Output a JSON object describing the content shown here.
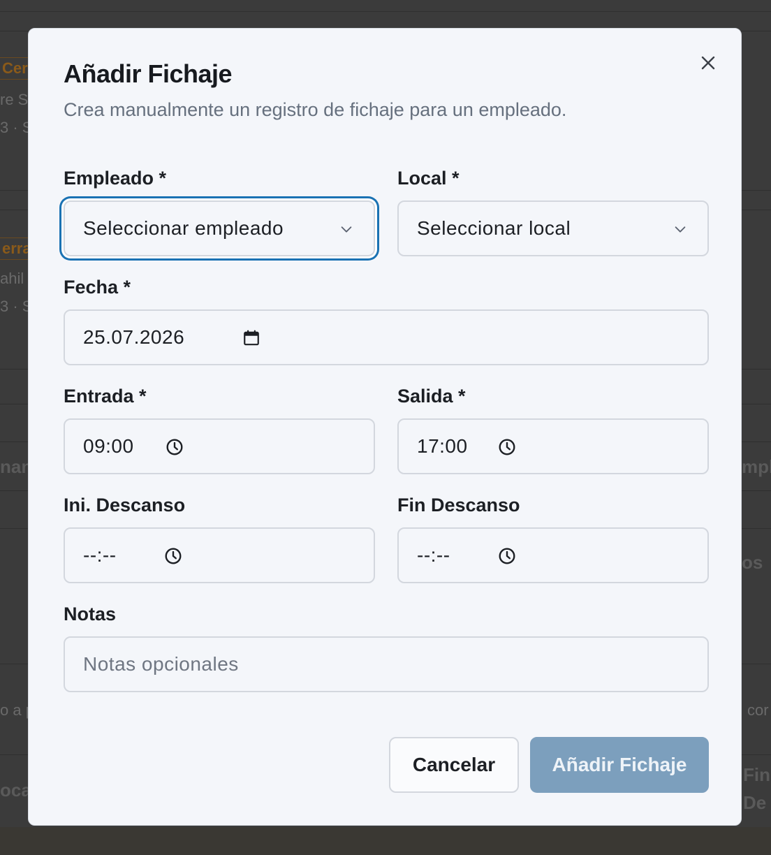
{
  "background": {
    "fragments": [
      "Cer",
      "re S",
      "3 · S",
      "erra",
      "ahil",
      "3 · S",
      "nan",
      "mpl",
      "os",
      "o a p",
      "cor",
      "ocal",
      "Fin",
      "De"
    ]
  },
  "dialog": {
    "title": "Añadir Fichaje",
    "subtitle": "Crea manualmente un registro de fichaje para un empleado.",
    "close_icon": "close-icon"
  },
  "form": {
    "empleado": {
      "label": "Empleado *",
      "value": "Seleccionar empleado",
      "icon": "chevron-down-icon"
    },
    "local": {
      "label": "Local *",
      "value": "Seleccionar local",
      "icon": "chevron-down-icon"
    },
    "fecha": {
      "label": "Fecha *",
      "value": "25.07.2026",
      "icon": "calendar-icon"
    },
    "entrada": {
      "label": "Entrada *",
      "value": "09:00",
      "icon": "clock-icon"
    },
    "salida": {
      "label": "Salida *",
      "value": "17:00",
      "icon": "clock-icon"
    },
    "ini_descanso": {
      "label": "Ini. Descanso",
      "value": "--:--",
      "icon": "clock-icon"
    },
    "fin_descanso": {
      "label": "Fin Descanso",
      "value": "--:--",
      "icon": "clock-icon"
    },
    "notas": {
      "label": "Notas",
      "placeholder": "Notas opcionales",
      "value": ""
    }
  },
  "actions": {
    "cancel_label": "Cancelar",
    "submit_label": "Añadir Fichaje"
  },
  "colors": {
    "focus_ring": "#1a72b3",
    "primary_button": "#7c9fbd",
    "modal_bg": "#f4f6fa"
  }
}
